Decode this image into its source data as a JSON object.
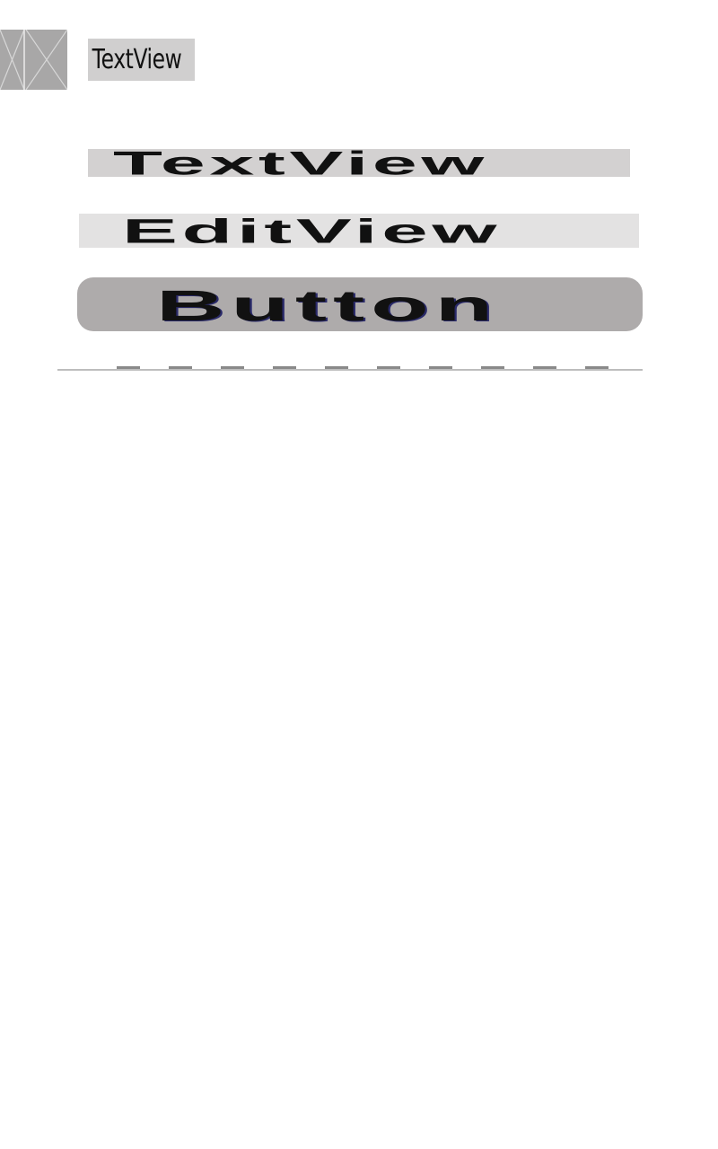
{
  "header": {
    "textview_label": "TextView"
  },
  "views": {
    "textview_label": "TextView",
    "editview_label": "EditView",
    "button_label": "Button"
  },
  "icons": {
    "placeholder": "image-placeholder-icon"
  },
  "colors": {
    "textview_bg": "#d3d1d1",
    "editview_bg": "#e3e2e2",
    "button_bg": "#aeabab"
  }
}
